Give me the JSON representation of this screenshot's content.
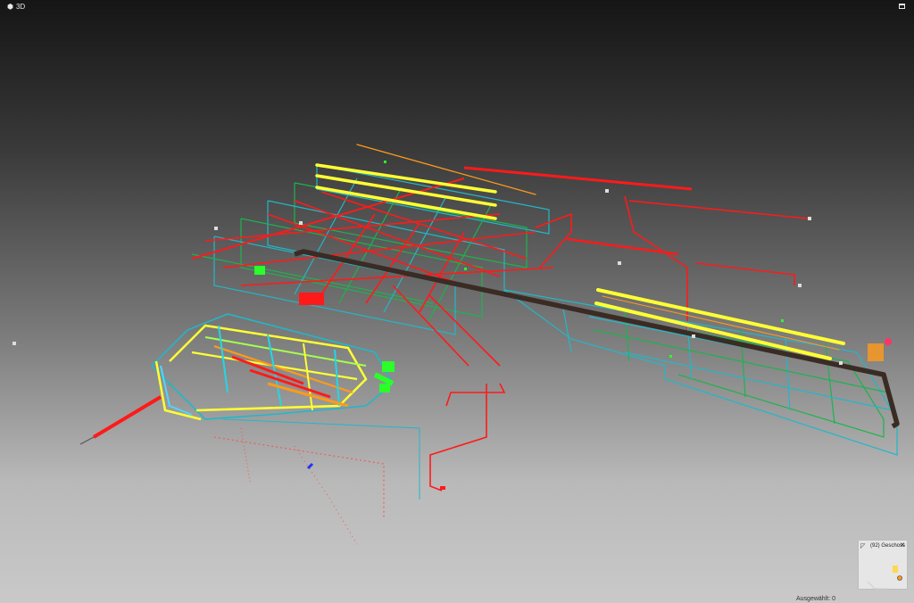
{
  "window": {
    "title": "3D"
  },
  "minimap": {
    "label": "(92) Geschoss"
  },
  "status": {
    "selected_text": "Ausgewählt: 0"
  },
  "colors": {
    "pipe_red": "#ff1a1a",
    "pipe_cyan": "#22b7c8",
    "pipe_green": "#1db34e",
    "pipe_yellow": "#ffff33",
    "pipe_orange": "#ff9a1a",
    "duct_dark": "#3a2b24"
  }
}
